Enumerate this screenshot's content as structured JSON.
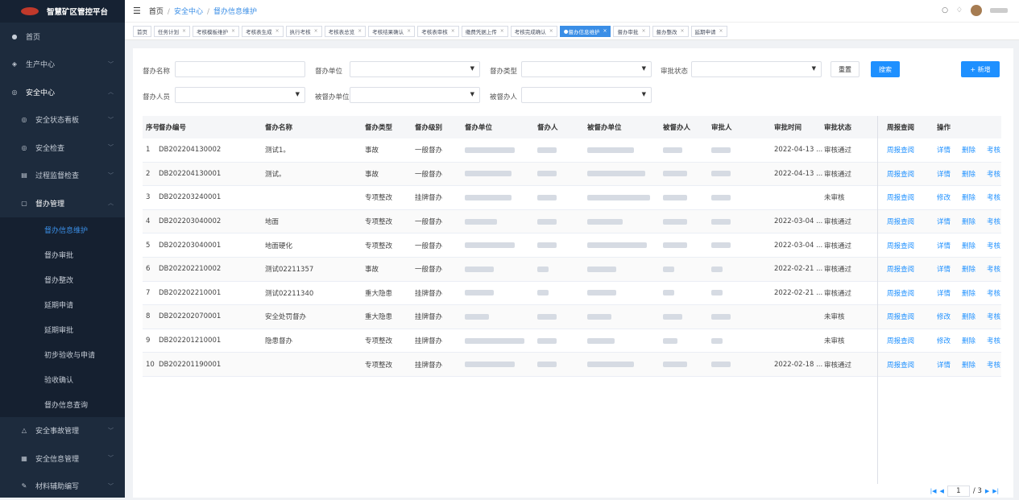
{
  "app_title": "智慧矿区管控平台",
  "sidebar": [
    {
      "label": "首页",
      "icon": "dashboard-icon"
    },
    {
      "label": "生产中心",
      "icon": "layers-icon"
    },
    {
      "label": "安全中心",
      "icon": "shield-icon"
    },
    {
      "label": "安全状态看板",
      "icon": "shield-icon"
    },
    {
      "label": "安全检查",
      "icon": "shield-icon"
    },
    {
      "label": "过程监督检查",
      "icon": "checklist-icon"
    },
    {
      "label": "督办管理",
      "icon": "document-icon"
    },
    {
      "label": "督办信息维护"
    },
    {
      "label": "督办审批"
    },
    {
      "label": "督办整改"
    },
    {
      "label": "延期申请"
    },
    {
      "label": "延期审批"
    },
    {
      "label": "初步验收与申请"
    },
    {
      "label": "验收确认"
    },
    {
      "label": "督办信息查询"
    },
    {
      "label": "安全事故管理",
      "icon": "warning-icon"
    },
    {
      "label": "安全信息管理",
      "icon": "grid-icon"
    },
    {
      "label": "材料辅助编写",
      "icon": "edit-icon"
    }
  ],
  "breadcrumb": [
    "首页",
    "安全中心",
    "督办信息维护"
  ],
  "tabs": [
    "首页",
    "任务计划",
    "考核模板维护",
    "考核表生成",
    "执行考核",
    "考核表总览",
    "考核结果确认",
    "考核表审核",
    "缴费凭据上传",
    "考核完成确认",
    "督办信息维护",
    "督办审批",
    "督办整改",
    "延期申请"
  ],
  "filters": {
    "name_label": "督办名称",
    "unit_label": "督办单位",
    "type_label": "督办类型",
    "status_label": "审批状态",
    "person_label": "督办人员",
    "target_unit_label": "被督办单位",
    "target_person_label": "被督办人",
    "reset": "重置",
    "search": "搜索",
    "add": "+ 新增"
  },
  "table": {
    "headers": [
      "序号",
      "督办编号",
      "督办名称",
      "督办类型",
      "督办级别",
      "督办单位",
      "督办人",
      "被督办单位",
      "被督办人",
      "审批人",
      "审批时间",
      "审批状态",
      "周报查阅",
      "操作"
    ],
    "rows": [
      {
        "no": "1",
        "code": "DB202204130002",
        "name": "测试1。",
        "type": "事故",
        "level": "一般督办",
        "time": "2022-04-13 ...",
        "status": "审核通过",
        "report": "周报查阅",
        "ops": [
          "详情",
          "删除",
          "考核"
        ]
      },
      {
        "no": "2",
        "code": "DB202204130001",
        "name": "测试。",
        "type": "事故",
        "level": "一般督办",
        "time": "2022-04-13 ...",
        "status": "审核通过",
        "report": "周报查阅",
        "ops": [
          "详情",
          "删除",
          "考核"
        ]
      },
      {
        "no": "3",
        "code": "DB202203240001",
        "name": "",
        "type": "专项整改",
        "level": "挂牌督办",
        "time": "",
        "status": "未审核",
        "report": "周报查阅",
        "ops": [
          "修改",
          "删除",
          "考核"
        ]
      },
      {
        "no": "4",
        "code": "DB202203040002",
        "name": "地面",
        "type": "专项整改",
        "level": "一般督办",
        "time": "2022-03-04 ...",
        "status": "审核通过",
        "report": "周报查阅",
        "ops": [
          "详情",
          "删除",
          "考核"
        ]
      },
      {
        "no": "5",
        "code": "DB202203040001",
        "name": "地面硬化",
        "type": "专项整改",
        "level": "一般督办",
        "time": "2022-03-04 ...",
        "status": "审核通过",
        "report": "周报查阅",
        "ops": [
          "详情",
          "删除",
          "考核"
        ]
      },
      {
        "no": "6",
        "code": "DB202202210002",
        "name": "测试02211357",
        "type": "事故",
        "level": "一般督办",
        "time": "2022-02-21 ...",
        "status": "审核通过",
        "report": "周报查阅",
        "ops": [
          "详情",
          "删除",
          "考核"
        ]
      },
      {
        "no": "7",
        "code": "DB202202210001",
        "name": "测试02211340",
        "type": "重大隐患",
        "level": "挂牌督办",
        "time": "2022-02-21 ...",
        "status": "审核通过",
        "report": "周报查阅",
        "ops": [
          "详情",
          "删除",
          "考核"
        ]
      },
      {
        "no": "8",
        "code": "DB202202070001",
        "name": "安全处罚督办",
        "type": "重大隐患",
        "level": "挂牌督办",
        "time": "",
        "status": "未审核",
        "report": "周报查阅",
        "ops": [
          "修改",
          "删除",
          "考核"
        ]
      },
      {
        "no": "9",
        "code": "DB202201210001",
        "name": "隐患督办",
        "type": "专项整改",
        "level": "挂牌督办",
        "time": "",
        "status": "未审核",
        "report": "周报查阅",
        "ops": [
          "修改",
          "删除",
          "考核"
        ]
      },
      {
        "no": "10",
        "code": "DB202201190001",
        "name": "",
        "type": "专项整改",
        "level": "挂牌督办",
        "time": "2022-02-18 ...",
        "status": "审核通过",
        "report": "周报查阅",
        "ops": [
          "详情",
          "删除",
          "考核"
        ]
      }
    ]
  },
  "pager": {
    "page": "1",
    "total": "/ 3"
  }
}
